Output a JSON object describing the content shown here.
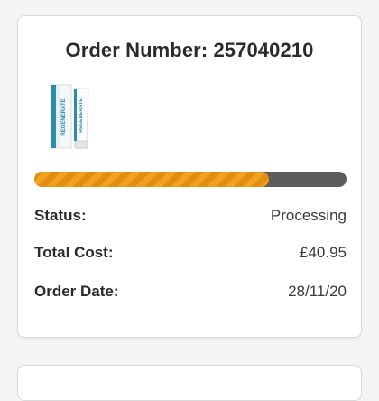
{
  "order": {
    "title": "Order Number: 257040210",
    "product_image": {
      "icon": "toothpaste-tube-and-box-thumbnail",
      "product_text": "REGENERATE"
    },
    "progress": {
      "fraction": 0.75,
      "fill_color": "#f0a21c",
      "track_color": "#5c5c5c"
    },
    "status": {
      "label": "Status:",
      "value": "Processing"
    },
    "total_cost": {
      "label": "Total Cost:",
      "value": "£40.95"
    },
    "order_date": {
      "label": "Order Date:",
      "value": "28/11/20"
    }
  }
}
